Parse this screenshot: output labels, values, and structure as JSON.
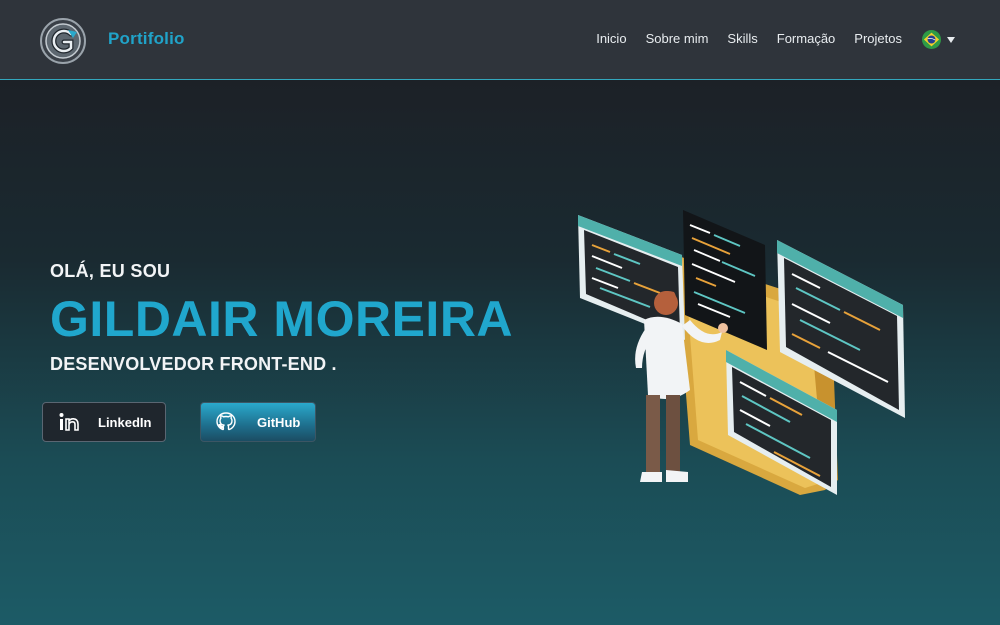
{
  "navbar": {
    "brand": "Portifolio",
    "links": [
      "Inicio",
      "Sobre mim",
      "Skills",
      "Formação",
      "Projetos"
    ],
    "language_flag": "brazil-flag-icon"
  },
  "hero": {
    "greeting": "OLÁ, EU SOU",
    "name": "GILDAIR MOREIRA",
    "role": "DESENVOLVEDOR FRONT-END ."
  },
  "buttons": {
    "linkedin": {
      "label": "LinkedIn",
      "icon": "linkedin-icon"
    },
    "github": {
      "label": "GitHub",
      "icon": "github-icon"
    }
  },
  "colors": {
    "accent": "#20a7cd",
    "navbar_bg": "#2f343b",
    "navbar_border": "#33a7bd"
  }
}
